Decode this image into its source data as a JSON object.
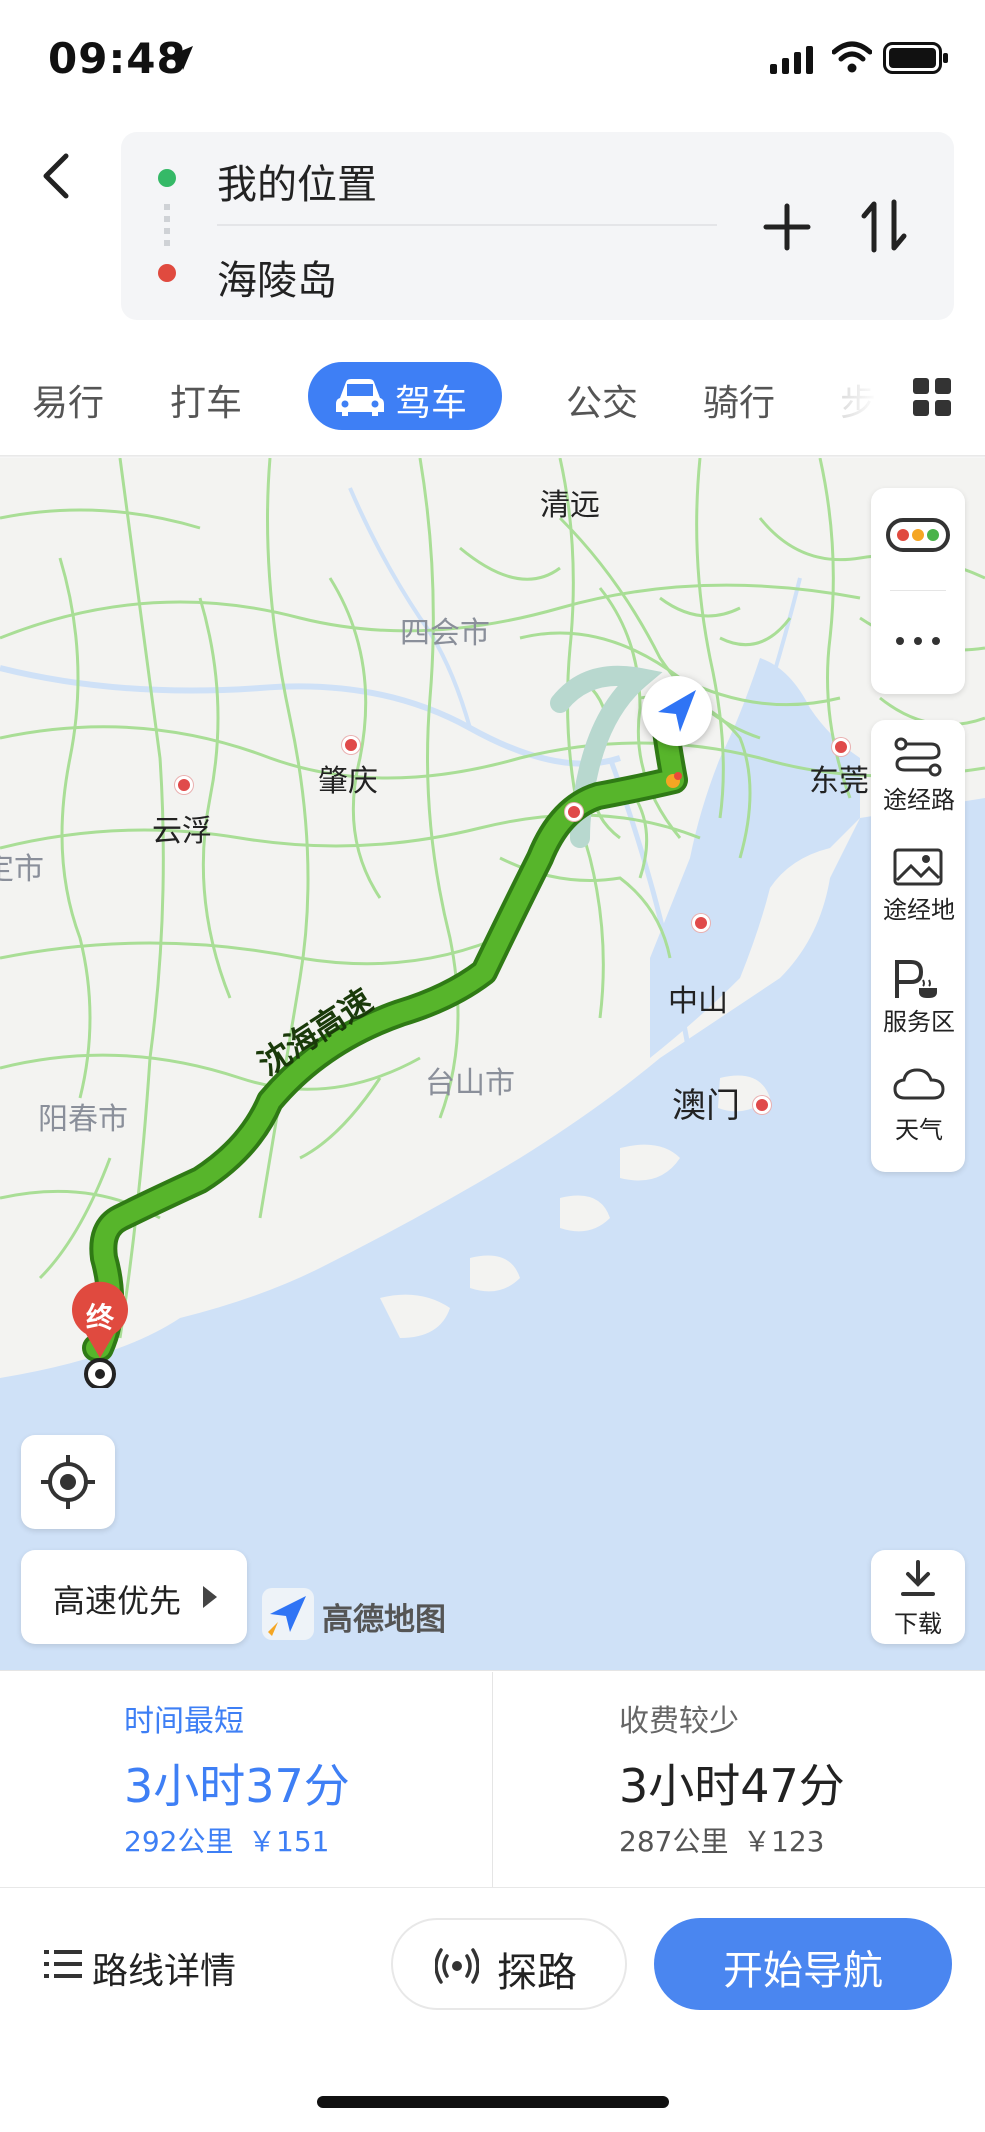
{
  "status": {
    "time": "09:48"
  },
  "route": {
    "origin": "我的位置",
    "destination": "海陵岛"
  },
  "tabs": [
    {
      "label": "易行"
    },
    {
      "label": "打车"
    },
    {
      "label": "驾车",
      "selected": true
    },
    {
      "label": "公交"
    },
    {
      "label": "骑行"
    },
    {
      "label": "步"
    }
  ],
  "map": {
    "labels": {
      "qingyuan": "清远",
      "sihui": "四会市",
      "zhaoqing": "肇庆",
      "yunfu": "云浮",
      "dongguan": "东莞",
      "zhongshan": "中山",
      "macau": "澳门",
      "taishan": "台山市",
      "yangchun": "阳春市",
      "left_edge": "定市",
      "highway": "沈海高速",
      "end_marker": "终"
    },
    "tools": {
      "waypoint_route": "途经路",
      "waypoint_place": "途经地",
      "service_area": "服务区",
      "weather": "天气",
      "download": "下载"
    },
    "preference": "高速优先",
    "logo": "高德地图"
  },
  "options": [
    {
      "tag": "时间最短",
      "duration": "3小时37分",
      "distance": "292公里",
      "cost": "￥151",
      "selected": true
    },
    {
      "tag": "收费较少",
      "duration": "3小时47分",
      "distance": "287公里",
      "cost": "￥123",
      "selected": false
    }
  ],
  "actions": {
    "details": "路线详情",
    "explore": "探路",
    "navigate": "开始导航"
  },
  "colors": {
    "accent": "#3e7ff5",
    "route_green": "#57b52b",
    "origin": "#35b967",
    "destination": "#e04a3f"
  }
}
